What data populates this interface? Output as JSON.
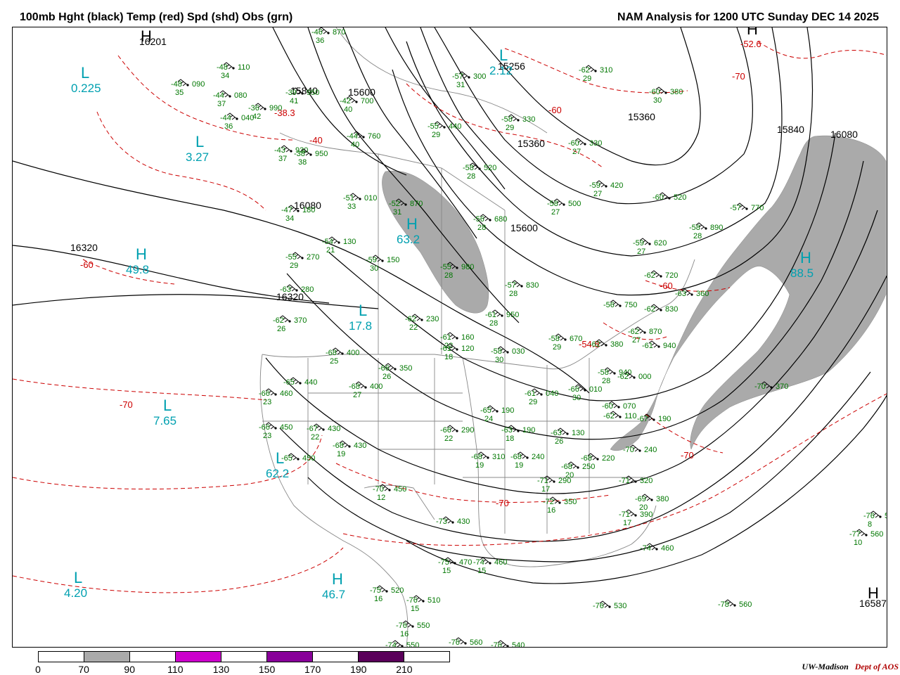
{
  "header": {
    "title_left": "100mb Hght (black) Temp (red) Spd (shd) Obs (grn)",
    "title_right": "NAM Analysis for 1200 UTC Sunday  DEC 14 2025"
  },
  "colors": {
    "height": "#000000",
    "temp": "#cc0000",
    "obs": "#007700",
    "center": "#00a0b0",
    "shade": "#aaaaaa",
    "border": "#888888"
  },
  "height_labels": [
    "16201",
    "15840",
    "15600",
    "15256",
    "15360",
    "15360",
    "15840",
    "16080",
    "16080",
    "15600",
    "16320",
    "16320",
    "16587"
  ],
  "temp_labels": [
    "-38.3",
    "-40",
    "-60",
    "-60",
    "-60",
    "-70",
    "-70",
    "-70",
    "-70",
    "-54.8",
    "-52.6"
  ],
  "centers": [
    {
      "letter": "L",
      "value": "0.225"
    },
    {
      "letter": "L",
      "value": "3.27"
    },
    {
      "letter": "H",
      "value": "49.8"
    },
    {
      "letter": "L",
      "value": "7.65"
    },
    {
      "letter": "L",
      "value": "4.20"
    },
    {
      "letter": "H",
      "value": "46.7"
    },
    {
      "letter": "L",
      "value": "17.8"
    },
    {
      "letter": "L",
      "value": "62.2"
    },
    {
      "letter": "H",
      "value": "63.2"
    },
    {
      "letter": "L",
      "value": "2.12"
    },
    {
      "letter": "H",
      "value": "88.5"
    },
    {
      "letter": "H",
      "value": ""
    },
    {
      "letter": "H",
      "value": ""
    },
    {
      "letter": "H",
      "value": ""
    }
  ],
  "observations": [
    {
      "t": "-46",
      "d": "36",
      "h": "870"
    },
    {
      "t": "-48",
      "d": "34",
      "h": "110"
    },
    {
      "t": "-48",
      "d": "35",
      "h": "090"
    },
    {
      "t": "-44",
      "d": "37",
      "h": "080"
    },
    {
      "t": "-36",
      "d": "42",
      "h": "990"
    },
    {
      "t": "-44",
      "d": "36",
      "h": "040"
    },
    {
      "t": "-39",
      "d": "41",
      "h": "950"
    },
    {
      "t": "-42",
      "d": "40",
      "h": "700"
    },
    {
      "t": "-44",
      "d": "40",
      "h": "760"
    },
    {
      "t": "-43",
      "d": "37",
      "h": "930"
    },
    {
      "t": "-38",
      "d": "38",
      "h": "950"
    },
    {
      "t": "-57",
      "d": "31",
      "h": "300"
    },
    {
      "t": "-62",
      "d": "29",
      "h": "310"
    },
    {
      "t": "-60",
      "d": "30",
      "h": "380"
    },
    {
      "t": "-55",
      "d": "29",
      "h": "440"
    },
    {
      "t": "-58",
      "d": "29",
      "h": "330"
    },
    {
      "t": "-60",
      "d": "27",
      "h": "330"
    },
    {
      "t": "-58",
      "d": "28",
      "h": "520"
    },
    {
      "t": "-59",
      "d": "27",
      "h": "420"
    },
    {
      "t": "-60",
      "d": "",
      "h": "520"
    },
    {
      "t": "-58",
      "d": "27",
      "h": "500"
    },
    {
      "t": "-51",
      "d": "33",
      "h": "010"
    },
    {
      "t": "-52",
      "d": "31",
      "h": "870"
    },
    {
      "t": "-47",
      "d": "34",
      "h": "180"
    },
    {
      "t": "-56",
      "d": "28",
      "h": "680"
    },
    {
      "t": "-57",
      "d": "",
      "h": "770"
    },
    {
      "t": "-58",
      "d": "28",
      "h": "890"
    },
    {
      "t": "-54",
      "d": "21",
      "h": "130"
    },
    {
      "t": "-59",
      "d": "27",
      "h": "620"
    },
    {
      "t": "-55",
      "d": "29",
      "h": "270"
    },
    {
      "t": "-59",
      "d": "30",
      "h": "150"
    },
    {
      "t": "-55",
      "d": "28",
      "h": "980"
    },
    {
      "t": "-62",
      "d": "",
      "h": "720"
    },
    {
      "t": "-57",
      "d": "28",
      "h": "830"
    },
    {
      "t": "-63",
      "d": "",
      "h": "280"
    },
    {
      "t": "-63",
      "d": "",
      "h": "360"
    },
    {
      "t": "-56",
      "d": "",
      "h": "750"
    },
    {
      "t": "-62",
      "d": "",
      "h": "830"
    },
    {
      "t": "-62",
      "d": "26",
      "h": "370"
    },
    {
      "t": "-62",
      "d": "22",
      "h": "230"
    },
    {
      "t": "-61",
      "d": "28",
      "h": "950"
    },
    {
      "t": "-61",
      "d": "22",
      "h": "160"
    },
    {
      "t": "-62",
      "d": "27",
      "h": "870"
    },
    {
      "t": "-58",
      "d": "29",
      "h": "670"
    },
    {
      "t": "-61",
      "d": "18",
      "h": "120"
    },
    {
      "t": "-58",
      "d": "30",
      "h": "030"
    },
    {
      "t": "-62",
      "d": "",
      "h": "380"
    },
    {
      "t": "-61",
      "d": "",
      "h": "940"
    },
    {
      "t": "-68",
      "d": "25",
      "h": "400"
    },
    {
      "t": "-58",
      "d": "28",
      "h": "940"
    },
    {
      "t": "-66",
      "d": "26",
      "h": "350"
    },
    {
      "t": "-62",
      "d": "",
      "h": "000"
    },
    {
      "t": "-65",
      "d": "",
      "h": "440"
    },
    {
      "t": "-68",
      "d": "27",
      "h": "400"
    },
    {
      "t": "-61",
      "d": "29",
      "h": "040"
    },
    {
      "t": "-66",
      "d": "30",
      "h": "010"
    },
    {
      "t": "-66",
      "d": "23",
      "h": "460"
    },
    {
      "t": "-70",
      "d": "",
      "h": "370"
    },
    {
      "t": "-60",
      "d": "",
      "h": "070"
    },
    {
      "t": "-62",
      "d": "",
      "h": "110"
    },
    {
      "t": "-65",
      "d": "24",
      "h": "190"
    },
    {
      "t": "-67",
      "d": "",
      "h": "190"
    },
    {
      "t": "-66",
      "d": "23",
      "h": "450"
    },
    {
      "t": "-67",
      "d": "22",
      "h": "430"
    },
    {
      "t": "-66",
      "d": "22",
      "h": "290"
    },
    {
      "t": "-63",
      "d": "18",
      "h": "190"
    },
    {
      "t": "-63",
      "d": "26",
      "h": "130"
    },
    {
      "t": "-68",
      "d": "19",
      "h": "430"
    },
    {
      "t": "-70",
      "d": "",
      "h": "240"
    },
    {
      "t": "-65",
      "d": "",
      "h": "450"
    },
    {
      "t": "-68",
      "d": "19",
      "h": "310"
    },
    {
      "t": "-68",
      "d": "19",
      "h": "240"
    },
    {
      "t": "-68",
      "d": "20",
      "h": "250"
    },
    {
      "t": "-68",
      "d": "",
      "h": "220"
    },
    {
      "t": "-71",
      "d": "17",
      "h": "290"
    },
    {
      "t": "-71",
      "d": "",
      "h": "320"
    },
    {
      "t": "-70",
      "d": "12",
      "h": "450"
    },
    {
      "t": "-72",
      "d": "16",
      "h": "350"
    },
    {
      "t": "-69",
      "d": "20",
      "h": "380"
    },
    {
      "t": "-71",
      "d": "17",
      "h": "390"
    },
    {
      "t": "-73",
      "d": "",
      "h": "430"
    },
    {
      "t": "-76",
      "d": "8",
      "h": "5"
    },
    {
      "t": "-77",
      "d": "10",
      "h": "560"
    },
    {
      "t": "-74",
      "d": "",
      "h": "460"
    },
    {
      "t": "-75",
      "d": "15",
      "h": "470"
    },
    {
      "t": "-74",
      "d": "15",
      "h": "460"
    },
    {
      "t": "-75",
      "d": "16",
      "h": "520"
    },
    {
      "t": "-76",
      "d": "15",
      "h": "510"
    },
    {
      "t": "-76",
      "d": "",
      "h": "530"
    },
    {
      "t": "-78",
      "d": "",
      "h": "560"
    },
    {
      "t": "-76",
      "d": "16",
      "h": "550"
    },
    {
      "t": "-74",
      "d": "",
      "h": "550"
    },
    {
      "t": "-76",
      "d": "",
      "h": "560"
    },
    {
      "t": "-76",
      "d": "",
      "h": "540"
    }
  ],
  "legend": {
    "labels": [
      "0",
      "70",
      "90",
      "110",
      "130",
      "150",
      "170",
      "190",
      "210"
    ],
    "colors": [
      "#ffffff",
      "#aaaaaa",
      "#ffffff",
      "#cc00cc",
      "#ffffff",
      "#880099",
      "#ffffff",
      "#5a005a",
      "#ffffff"
    ]
  },
  "credit": {
    "org": "UW-Madison",
    "dept": "Dept of AOS"
  }
}
